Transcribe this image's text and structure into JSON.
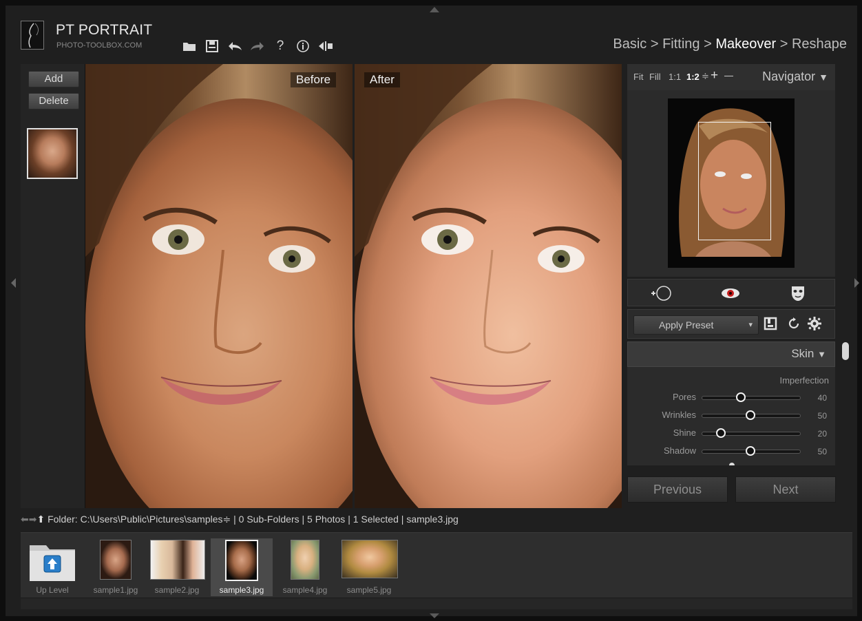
{
  "header": {
    "app_title": "PT PORTRAIT",
    "app_subtitle": "PHOTO-TOOLBOX.COM",
    "toolbar_icons": [
      "folder-open-icon",
      "save-icon",
      "undo-icon",
      "redo-icon",
      "help-icon",
      "info-icon",
      "compare-icon"
    ],
    "breadcrumb": {
      "step1": "Basic",
      "sep": " > ",
      "step2": "Fitting",
      "step3": "Makeover",
      "step4": "Reshape"
    }
  },
  "left_panel": {
    "add_label": "Add",
    "delete_label": "Delete"
  },
  "viewer": {
    "before_label": "Before",
    "after_label": "After"
  },
  "navigator": {
    "fit": "Fit",
    "fill": "Fill",
    "one_to_one": "1:1",
    "zoom": "1:2",
    "zoom_arrows": "≑",
    "plus": "+",
    "minus": "—",
    "title": "Navigator",
    "dropdown_arrow": "▼"
  },
  "tools": {
    "icons": [
      "skin-brush-icon",
      "red-eye-icon",
      "mask-icon"
    ]
  },
  "preset": {
    "label": "Apply Preset",
    "arrow": "▾"
  },
  "skin": {
    "title": "Skin",
    "arrow": "▼",
    "section": "Imperfection",
    "sliders": [
      {
        "label": "Pores",
        "value": "40",
        "fraction": 0.4
      },
      {
        "label": "Wrinkles",
        "value": "50",
        "fraction": 0.5
      },
      {
        "label": "Shine",
        "value": "20",
        "fraction": 0.2
      },
      {
        "label": "Shadow",
        "value": "50",
        "fraction": 0.5
      }
    ]
  },
  "navigation": {
    "previous": "Previous",
    "next": "Next"
  },
  "folder_bar": {
    "label": "Folder:",
    "path": "C:\\Users\\Public\\Pictures\\samples",
    "path_arrows": "≑",
    "subfolders": "0 Sub-Folders",
    "photos": "5 Photos",
    "selected": "1 Selected",
    "current": "sample3.jpg",
    "sep": "|"
  },
  "filmstrip": {
    "up_level": "Up Level",
    "files": [
      "sample1.jpg",
      "sample2.jpg",
      "sample3.jpg",
      "sample4.jpg",
      "sample5.jpg"
    ],
    "selected_file": "sample3.jpg"
  }
}
